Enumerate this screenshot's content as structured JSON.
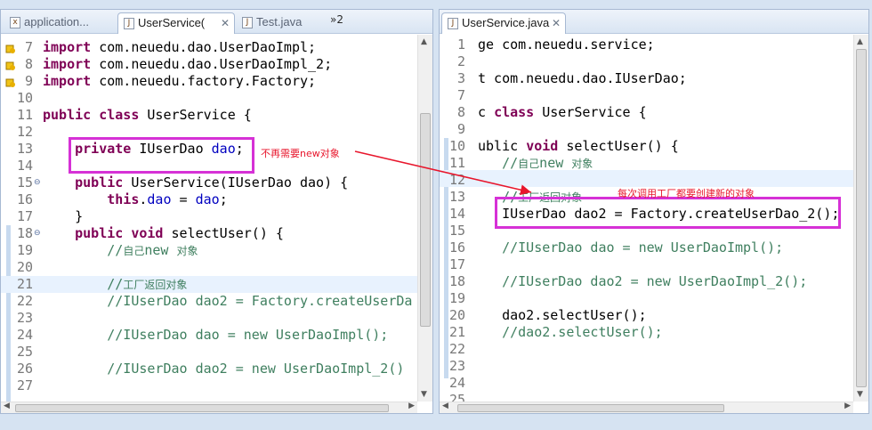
{
  "left": {
    "tabs": [
      {
        "label": "application...",
        "active": false
      },
      {
        "label": "UserService(",
        "active": true
      },
      {
        "label": "Test.java",
        "active": false
      }
    ],
    "overflow": "»2",
    "lines": [
      {
        "n": "7",
        "warn": true,
        "code": "import com.neuedu.dao.UserDaoImpl;"
      },
      {
        "n": "8",
        "warn": true,
        "code": "import com.neuedu.dao.UserDaoImpl_2;"
      },
      {
        "n": "9",
        "warn": true,
        "code": "import com.neuedu.factory.Factory;"
      },
      {
        "n": "10",
        "code": ""
      },
      {
        "n": "11",
        "code": "public class UserService {"
      },
      {
        "n": "12",
        "code": ""
      },
      {
        "n": "13",
        "code": "    private IUserDao dao;"
      },
      {
        "n": "14",
        "code": ""
      },
      {
        "n": "15",
        "fold": true,
        "code": "    public UserService(IUserDao dao) {"
      },
      {
        "n": "16",
        "code": "        this.dao = dao;"
      },
      {
        "n": "17",
        "code": "    }"
      },
      {
        "n": "18",
        "fold": true,
        "code": "    public void selectUser() {"
      },
      {
        "n": "19",
        "code": "        //自己new 对象"
      },
      {
        "n": "20",
        "code": ""
      },
      {
        "n": "21",
        "code": "        //工厂返回对象"
      },
      {
        "n": "22",
        "code": "        //IUserDao dao2 = Factory.createUserDa"
      },
      {
        "n": "23",
        "code": ""
      },
      {
        "n": "24",
        "code": "        //IUserDao dao = new UserDaoImpl();"
      },
      {
        "n": "25",
        "code": ""
      },
      {
        "n": "26",
        "code": "        //IUserDao dao2 = new UserDaoImpl_2()"
      },
      {
        "n": "27",
        "code": ""
      }
    ],
    "annotation": "不再需要new对象"
  },
  "right": {
    "tabs": [
      {
        "label": "UserService.java",
        "active": true
      }
    ],
    "lines": [
      {
        "n": "1",
        "code": "ge com.neuedu.service;"
      },
      {
        "n": "2",
        "code": ""
      },
      {
        "n": "3",
        "code": "t com.neuedu.dao.IUserDao;"
      },
      {
        "n": "7",
        "code": ""
      },
      {
        "n": "8",
        "code": "c class UserService {"
      },
      {
        "n": "9",
        "code": ""
      },
      {
        "n": "10",
        "code": "ublic void selectUser() {"
      },
      {
        "n": "11",
        "code": "   //自己new 对象"
      },
      {
        "n": "12",
        "code": ""
      },
      {
        "n": "13",
        "code": "   //工厂返回对象"
      },
      {
        "n": "14",
        "code": "   IUserDao dao2 = Factory.createUserDao_2();"
      },
      {
        "n": "15",
        "code": ""
      },
      {
        "n": "16",
        "code": "   //IUserDao dao = new UserDaoImpl();"
      },
      {
        "n": "17",
        "code": ""
      },
      {
        "n": "18",
        "code": "   //IUserDao dao2 = new UserDaoImpl_2();"
      },
      {
        "n": "19",
        "code": ""
      },
      {
        "n": "20",
        "code": "   dao2.selectUser();"
      },
      {
        "n": "21",
        "code": "   //dao2.selectUser();"
      },
      {
        "n": "22",
        "code": ""
      },
      {
        "n": "23",
        "code": ""
      },
      {
        "n": "24",
        "code": ""
      },
      {
        "n": "25",
        "code": ""
      }
    ],
    "annotation": "每次调用工厂都要创建新的对象"
  },
  "colors": {
    "keyword": "#7f0055",
    "field": "#0000c0",
    "comment": "#3f7f5f",
    "box": "#d631d6",
    "annotation": "#e8162c"
  }
}
